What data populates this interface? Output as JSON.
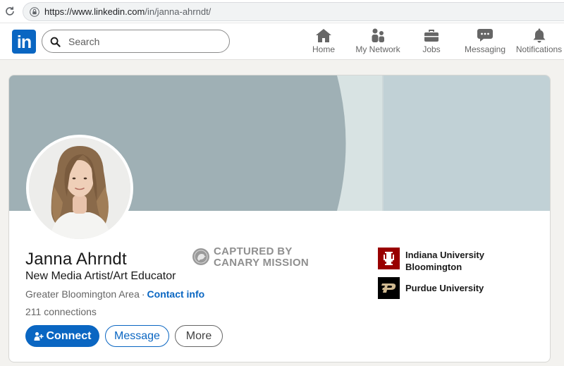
{
  "browser": {
    "url_host": "https://www.linkedin.com",
    "url_path": "/in/janna-ahrndt/"
  },
  "nav": {
    "logo_text": "in",
    "search_placeholder": "Search",
    "items": [
      {
        "label": "Home",
        "icon": "home-icon"
      },
      {
        "label": "My Network",
        "icon": "network-icon"
      },
      {
        "label": "Jobs",
        "icon": "briefcase-icon"
      },
      {
        "label": "Messaging",
        "icon": "chat-icon"
      },
      {
        "label": "Notifications",
        "icon": "bell-icon"
      }
    ]
  },
  "profile": {
    "name": "Janna Ahrndt",
    "headline": "New Media Artist/Art Educator",
    "location": "Greater Bloomington Area",
    "separator": "·",
    "contact_link": "Contact info",
    "connections": "211 connections",
    "buttons": {
      "connect": "Connect",
      "message": "Message",
      "more": "More"
    },
    "education": [
      {
        "name": "Indiana University Bloomington",
        "logo": "indiana-university-logo"
      },
      {
        "name": "Purdue University",
        "logo": "purdue-university-logo"
      }
    ]
  },
  "watermark": {
    "line1": "CAPTURED BY",
    "line2": "CANARY MISSION"
  },
  "colors": {
    "linkedin_blue": "#0a66c2",
    "banner_dark": "#9fb0b5",
    "banner_light": "#d8e3e3",
    "banner_right": "#c1d1d6",
    "iu_crimson": "#990000",
    "purdue_black": "#000000",
    "purdue_gold": "#cfb991"
  }
}
